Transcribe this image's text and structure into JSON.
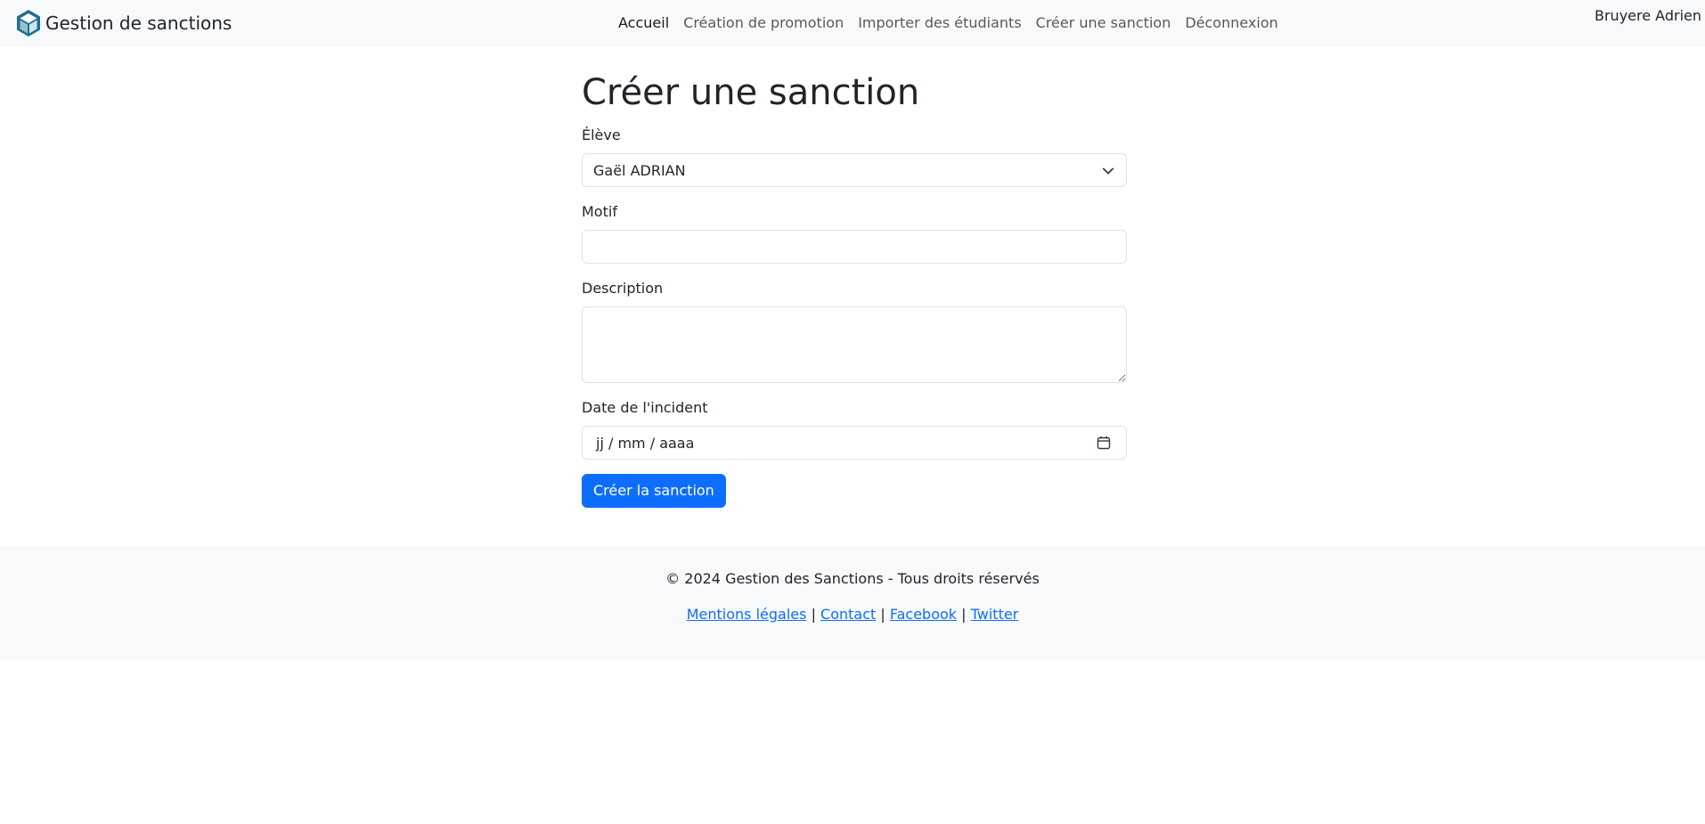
{
  "header": {
    "brand": "Gestion de sanctions",
    "nav": [
      {
        "label": "Accueil",
        "active": true
      },
      {
        "label": "Création de promotion"
      },
      {
        "label": "Importer des étudiants"
      },
      {
        "label": "Créer une sanction"
      },
      {
        "label": "Déconnexion"
      }
    ],
    "user": "Bruyere Adrien"
  },
  "form": {
    "title": "Créer une sanction",
    "student_label": "Élève",
    "student_value": "Gaël ADRIAN",
    "motif_label": "Motif",
    "motif_value": "",
    "description_label": "Description",
    "description_value": "",
    "date_label": "Date de l'incident",
    "date_placeholder": "jj / mm / aaaa",
    "submit_label": "Créer la sanction"
  },
  "footer": {
    "copyright": "© 2024 Gestion des Sanctions - Tous droits réservés",
    "links": [
      "Mentions légales",
      "Contact",
      "Facebook",
      "Twitter"
    ],
    "separator": "|"
  },
  "colors": {
    "primary": "#0d6efd",
    "nav_bg": "#f8f9fa",
    "logo": "#1f6f94"
  },
  "icons": {
    "brand": "cube-icon",
    "select": "chevron-down-icon",
    "date": "calendar-icon"
  }
}
